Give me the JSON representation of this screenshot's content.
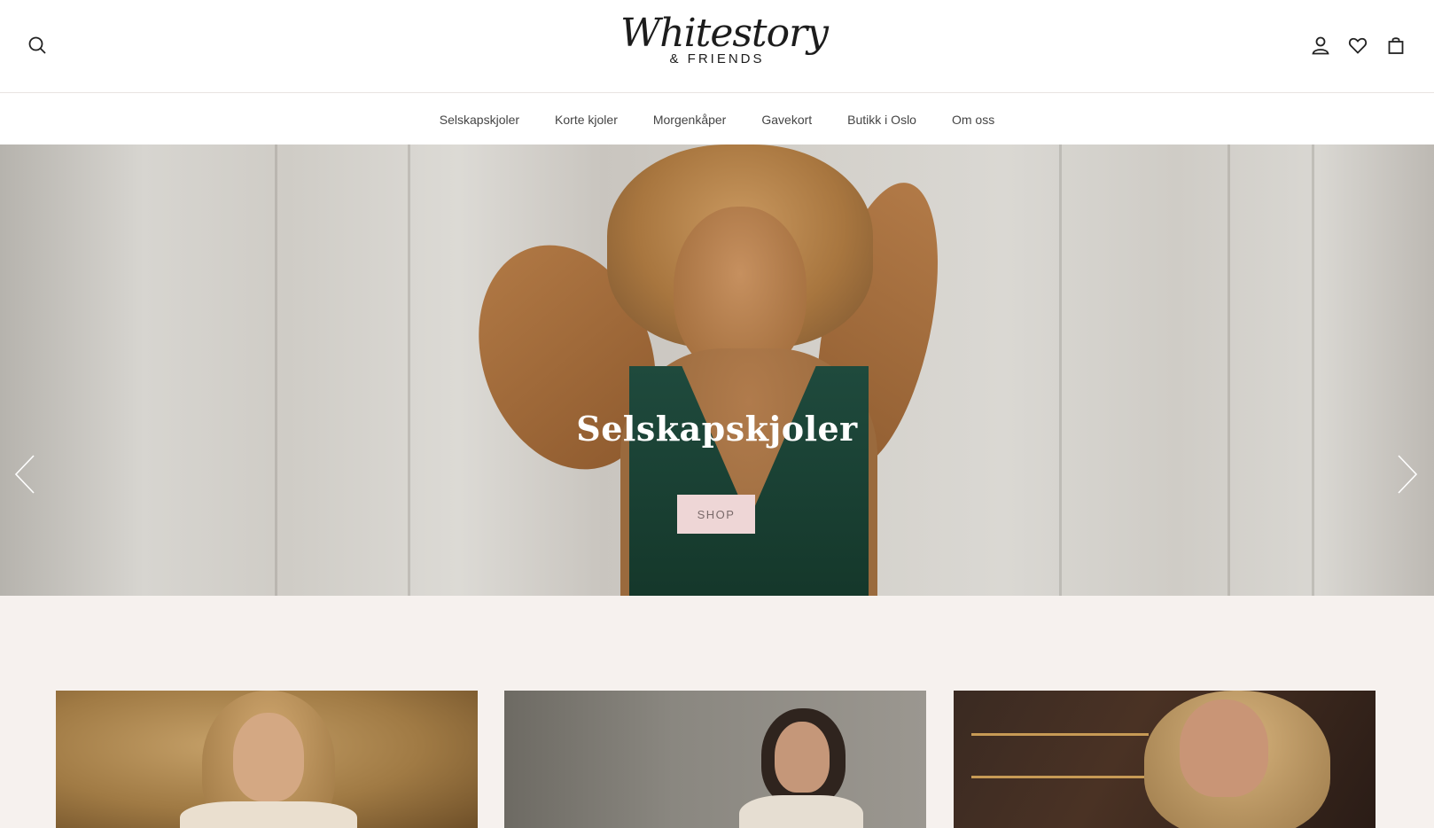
{
  "header": {
    "logo_script": "Whitestory",
    "logo_sub": "& FRIENDS",
    "icons": [
      "search-icon",
      "account-icon",
      "heart-icon",
      "bag-icon"
    ]
  },
  "nav": {
    "items": [
      {
        "label": "Selskapskjoler"
      },
      {
        "label": "Korte kjoler"
      },
      {
        "label": "Morgenkåper"
      },
      {
        "label": "Gavekort"
      },
      {
        "label": "Butikk i Oslo"
      },
      {
        "label": "Om oss"
      }
    ]
  },
  "hero": {
    "title": "Selskapskjoler",
    "button_label": "SHOP",
    "arrows": [
      "chevron-left-icon",
      "chevron-right-icon"
    ]
  },
  "colors": {
    "shop_button_bg": "#eed6d6",
    "section_bg": "#f6f1ee",
    "dress": "#1f4a3d"
  }
}
